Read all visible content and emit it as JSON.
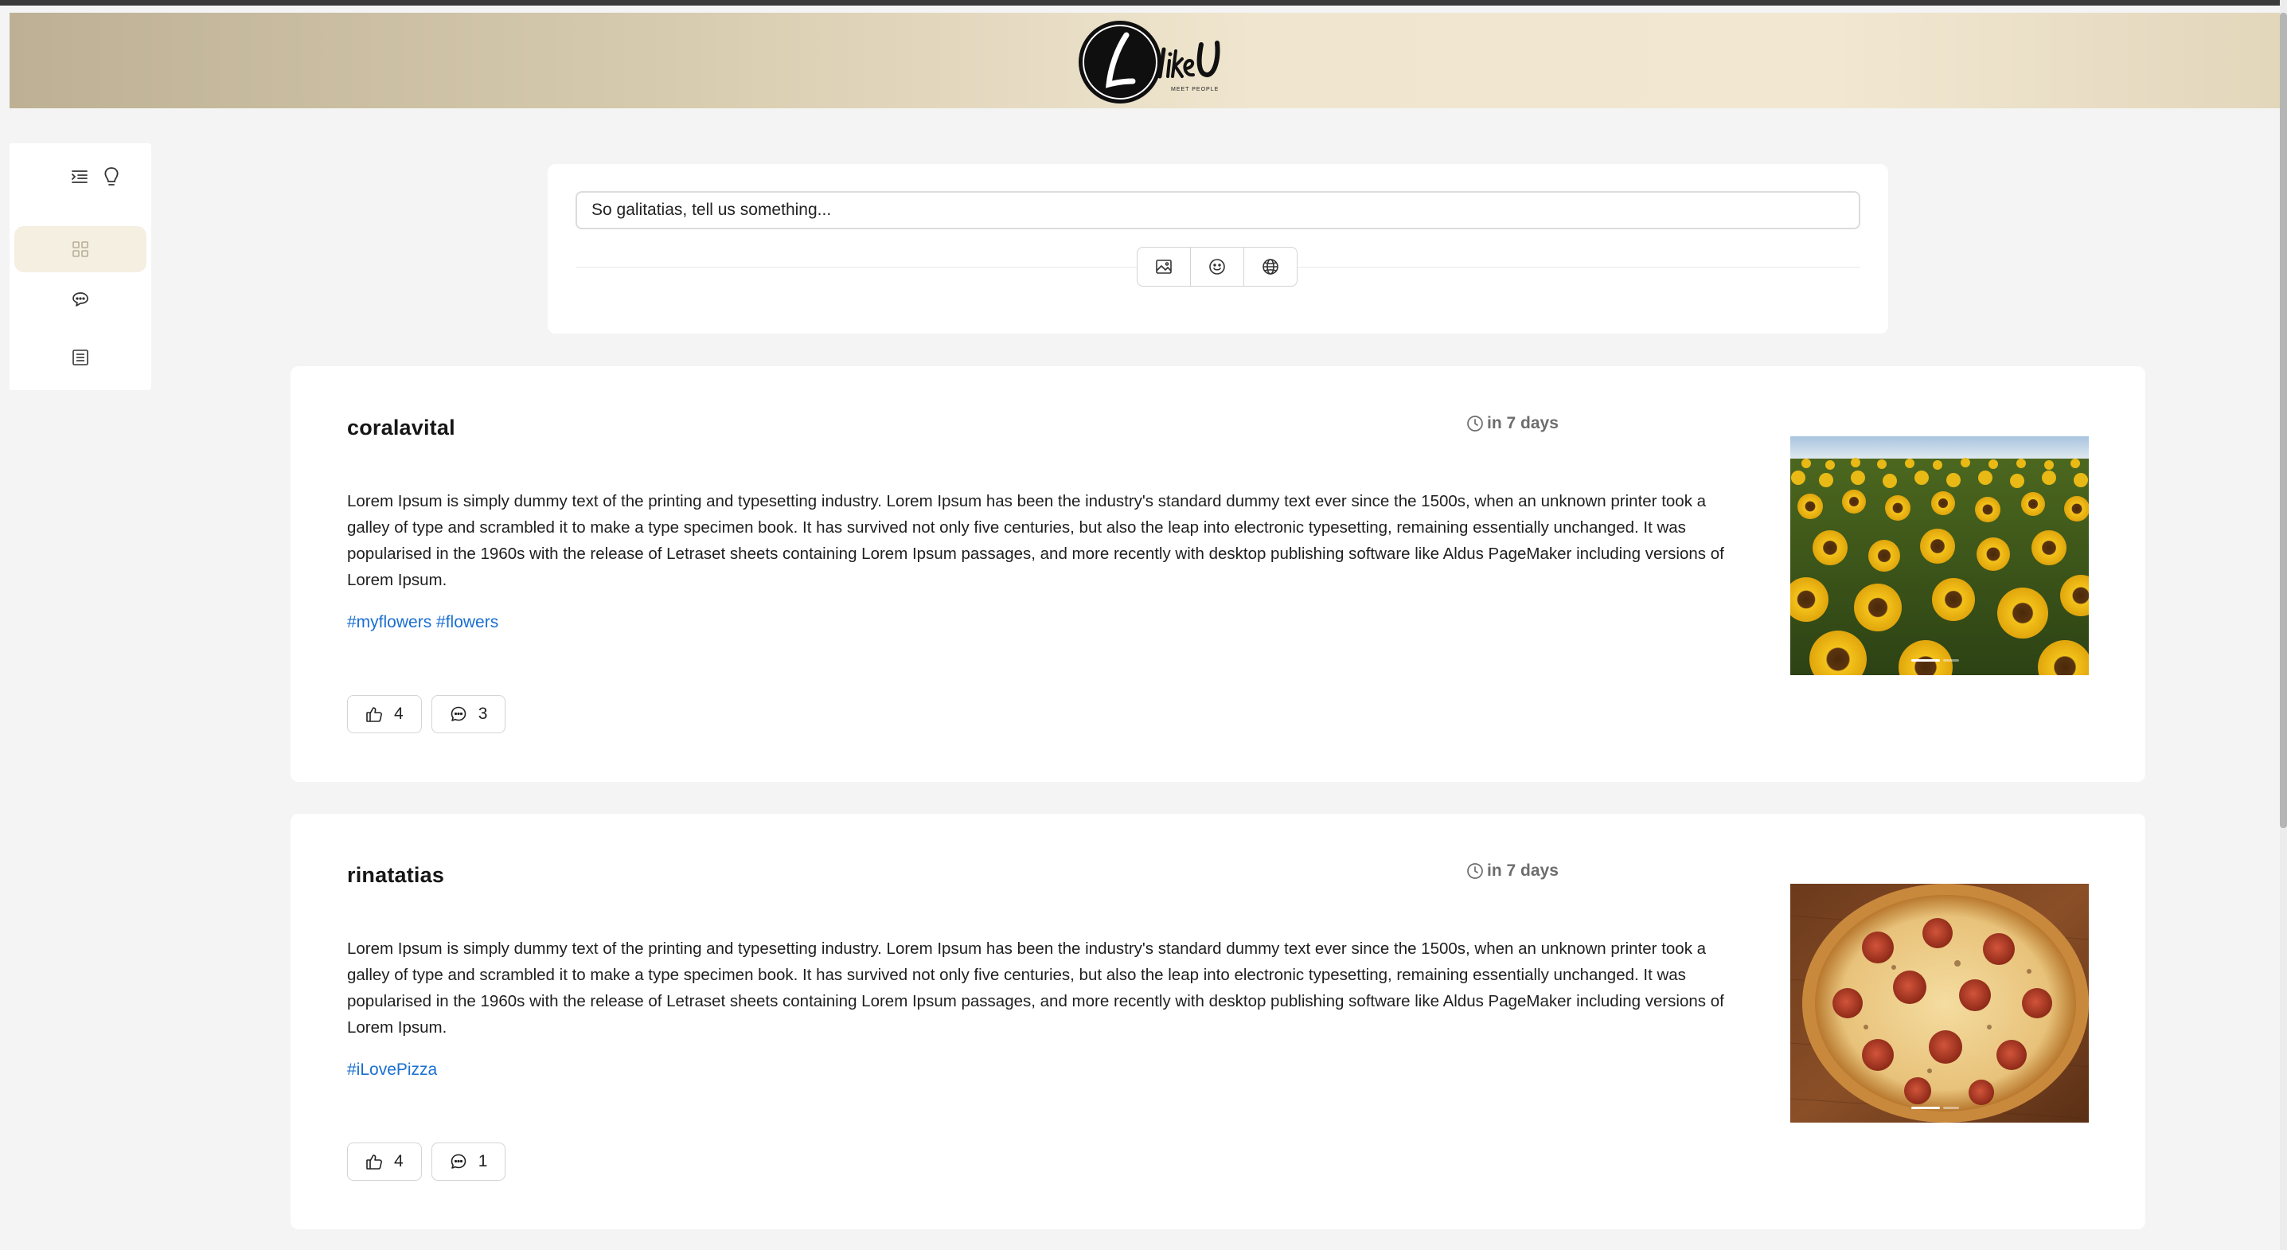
{
  "app": {
    "logo_text": "Like U",
    "logo_tagline": "MEET PEOPLE"
  },
  "sidebar": {
    "top_icons": [
      "outdent-icon",
      "lightbulb-icon"
    ],
    "items": [
      {
        "name": "grid-icon",
        "active": true
      },
      {
        "name": "chat-bubbles-icon",
        "active": false
      },
      {
        "name": "list-icon",
        "active": false
      }
    ]
  },
  "composer": {
    "placeholder": "So galitatias, tell us something...",
    "tools": [
      "image-icon",
      "emoji-icon",
      "globe-icon"
    ]
  },
  "colors": {
    "accent_active_bg": "#f4efe1",
    "hashtag": "#1a6fd1",
    "header_gradient_left": "#bdb094",
    "header_gradient_right": "#f2e8d2"
  },
  "posts": [
    {
      "author": "coralavital",
      "time": "in 7 days",
      "body": "Lorem Ipsum is simply dummy text of the printing and typesetting industry. Lorem Ipsum has been the industry's standard dummy text ever since the 1500s, when an unknown printer took a galley of type and scrambled it to make a type specimen book. It has survived not only five centuries, but also the leap into electronic typesetting, remaining essentially unchanged. It was popularised in the 1960s with the release of Letraset sheets containing Lorem Ipsum passages, and more recently with desktop publishing software like Aldus PageMaker including versions of Lorem Ipsum.",
      "tags": "#myflowers #flowers",
      "likes": "4",
      "comments": "3",
      "image": "sunflower-field"
    },
    {
      "author": "rinatatias",
      "time": "in 7 days",
      "body": "Lorem Ipsum is simply dummy text of the printing and typesetting industry. Lorem Ipsum has been the industry's standard dummy text ever since the 1500s, when an unknown printer took a galley of type and scrambled it to make a type specimen book. It has survived not only five centuries, but also the leap into electronic typesetting, remaining essentially unchanged. It was popularised in the 1960s with the release of Letraset sheets containing Lorem Ipsum passages, and more recently with desktop publishing software like Aldus PageMaker including versions of Lorem Ipsum.",
      "tags": "#iLovePizza",
      "likes": "4",
      "comments": "1",
      "image": "pepperoni-pizza"
    }
  ]
}
